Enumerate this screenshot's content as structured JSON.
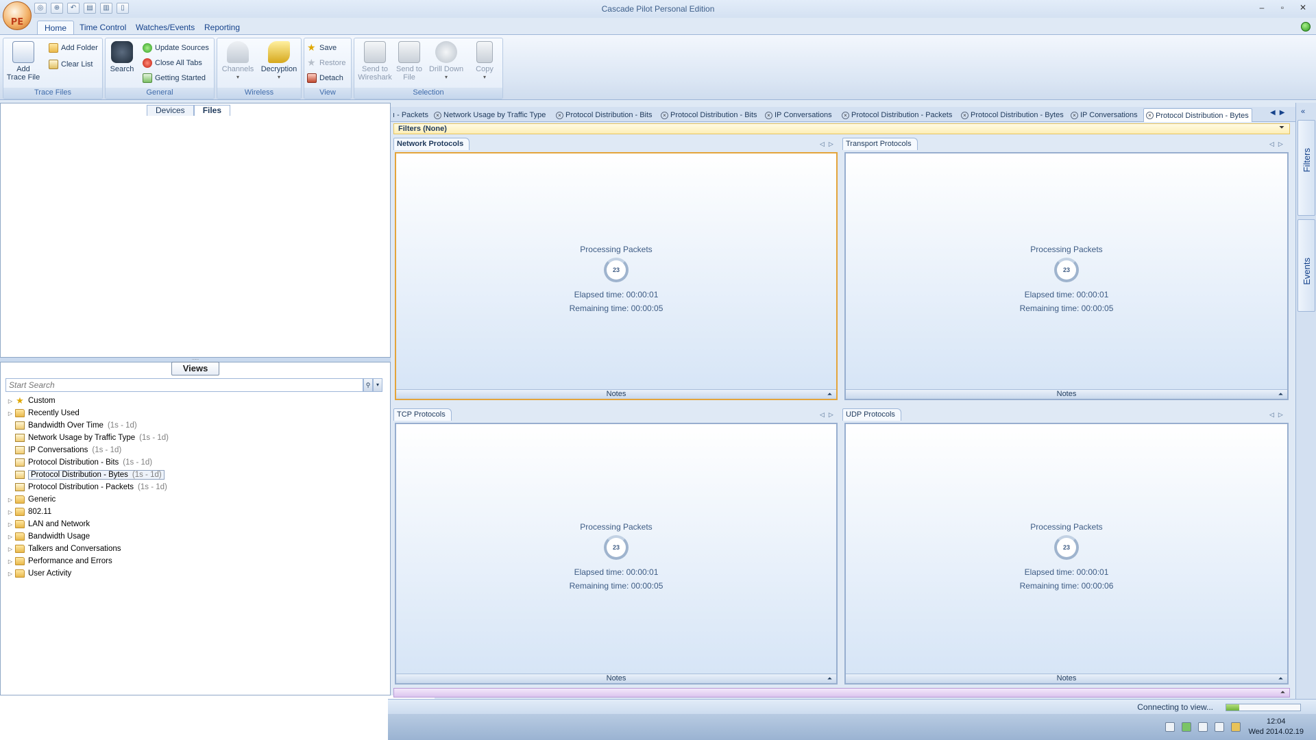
{
  "window": {
    "title": "Cascade Pilot Personal Edition",
    "orb_label": "PE",
    "controls": [
      "–",
      "▫",
      "✕"
    ]
  },
  "ribbon_tabs": [
    "Home",
    "Time Control",
    "Watches/Events",
    "Reporting"
  ],
  "ribbon": {
    "trace_files": {
      "label": "Trace Files",
      "add_trace_file": "Add Trace File",
      "add_folder": "Add Folder",
      "clear_list": "Clear List"
    },
    "general": {
      "label": "General",
      "search": "Search",
      "update_sources": "Update Sources",
      "close_all_tabs": "Close All Tabs",
      "getting_started": "Getting Started"
    },
    "wireless": {
      "label": "Wireless",
      "channels": "Channels",
      "decryption": "Decryption"
    },
    "view": {
      "label": "View",
      "save": "Save",
      "restore": "Restore",
      "detach": "Detach"
    },
    "selection": {
      "label": "Selection",
      "send_to_wireshark": "Send to Wireshark",
      "send_to_file": "Send to File",
      "drill_down": "Drill Down",
      "copy": "Copy"
    }
  },
  "left_tabs": [
    "Devices",
    "Files"
  ],
  "views": {
    "header": "Views",
    "search_placeholder": "Start Search",
    "tree": [
      {
        "label": "Custom",
        "type": "star",
        "expander": "▷"
      },
      {
        "label": "Recently Used",
        "type": "folder",
        "expander": "▷"
      },
      {
        "label": "Bandwidth Over Time",
        "type": "view",
        "duration": "(1s - 1d)"
      },
      {
        "label": "Network Usage by Traffic Type",
        "type": "view",
        "duration": "(1s - 1d)"
      },
      {
        "label": "IP Conversations",
        "type": "view",
        "duration": "(1s - 1d)"
      },
      {
        "label": "Protocol Distribution - Bits",
        "type": "view",
        "duration": "(1s - 1d)"
      },
      {
        "label": "Protocol Distribution - Bytes",
        "type": "view",
        "duration": "(1s - 1d)",
        "selected": true
      },
      {
        "label": "Protocol Distribution - Packets",
        "type": "view",
        "duration": "(1s - 1d)"
      },
      {
        "label": "Generic",
        "type": "folder",
        "expander": "▷"
      },
      {
        "label": "802.11",
        "type": "folder",
        "expander": "▷"
      },
      {
        "label": "LAN and Network",
        "type": "folder",
        "expander": "▷"
      },
      {
        "label": "Bandwidth Usage",
        "type": "folder",
        "expander": "▷"
      },
      {
        "label": "Talkers and Conversations",
        "type": "folder",
        "expander": "▷"
      },
      {
        "label": "Performance and Errors",
        "type": "folder",
        "expander": "▷"
      },
      {
        "label": "User Activity",
        "type": "folder",
        "expander": "▷"
      }
    ]
  },
  "doc_tabs": [
    "ı - Packets",
    "Network Usage by Traffic Type",
    "Protocol Distribution - Bits",
    "Protocol Distribution - Bits",
    "IP Conversations",
    "Protocol Distribution - Packets",
    "Protocol Distribution - Bytes",
    "IP Conversations",
    "Protocol Distribution - Bytes"
  ],
  "filters_label": "Filters (None)",
  "panels": [
    {
      "title": "Network Protocols",
      "status": "Processing Packets",
      "count": "23",
      "elapsed": "Elapsed time: 00:00:01",
      "remaining": "Remaining time: 00:00:05",
      "notes": "Notes"
    },
    {
      "title": "Transport Protocols",
      "status": "Processing Packets",
      "count": "23",
      "elapsed": "Elapsed time: 00:00:01",
      "remaining": "Remaining time: 00:00:05",
      "notes": "Notes"
    },
    {
      "title": "TCP Protocols",
      "status": "Processing Packets",
      "count": "23",
      "elapsed": "Elapsed time: 00:00:01",
      "remaining": "Remaining time: 00:00:05",
      "notes": "Notes"
    },
    {
      "title": "UDP Protocols",
      "status": "Processing Packets",
      "count": "23",
      "elapsed": "Elapsed time: 00:00:01",
      "remaining": "Remaining time: 00:00:06",
      "notes": "Notes"
    }
  ],
  "sidebar": {
    "filters": "Filters",
    "events": "Events"
  },
  "status": {
    "text": "Connecting to view...",
    "progress": 0.18
  },
  "clock": {
    "time": "12:04",
    "date": "Wed 2014.02.19"
  }
}
